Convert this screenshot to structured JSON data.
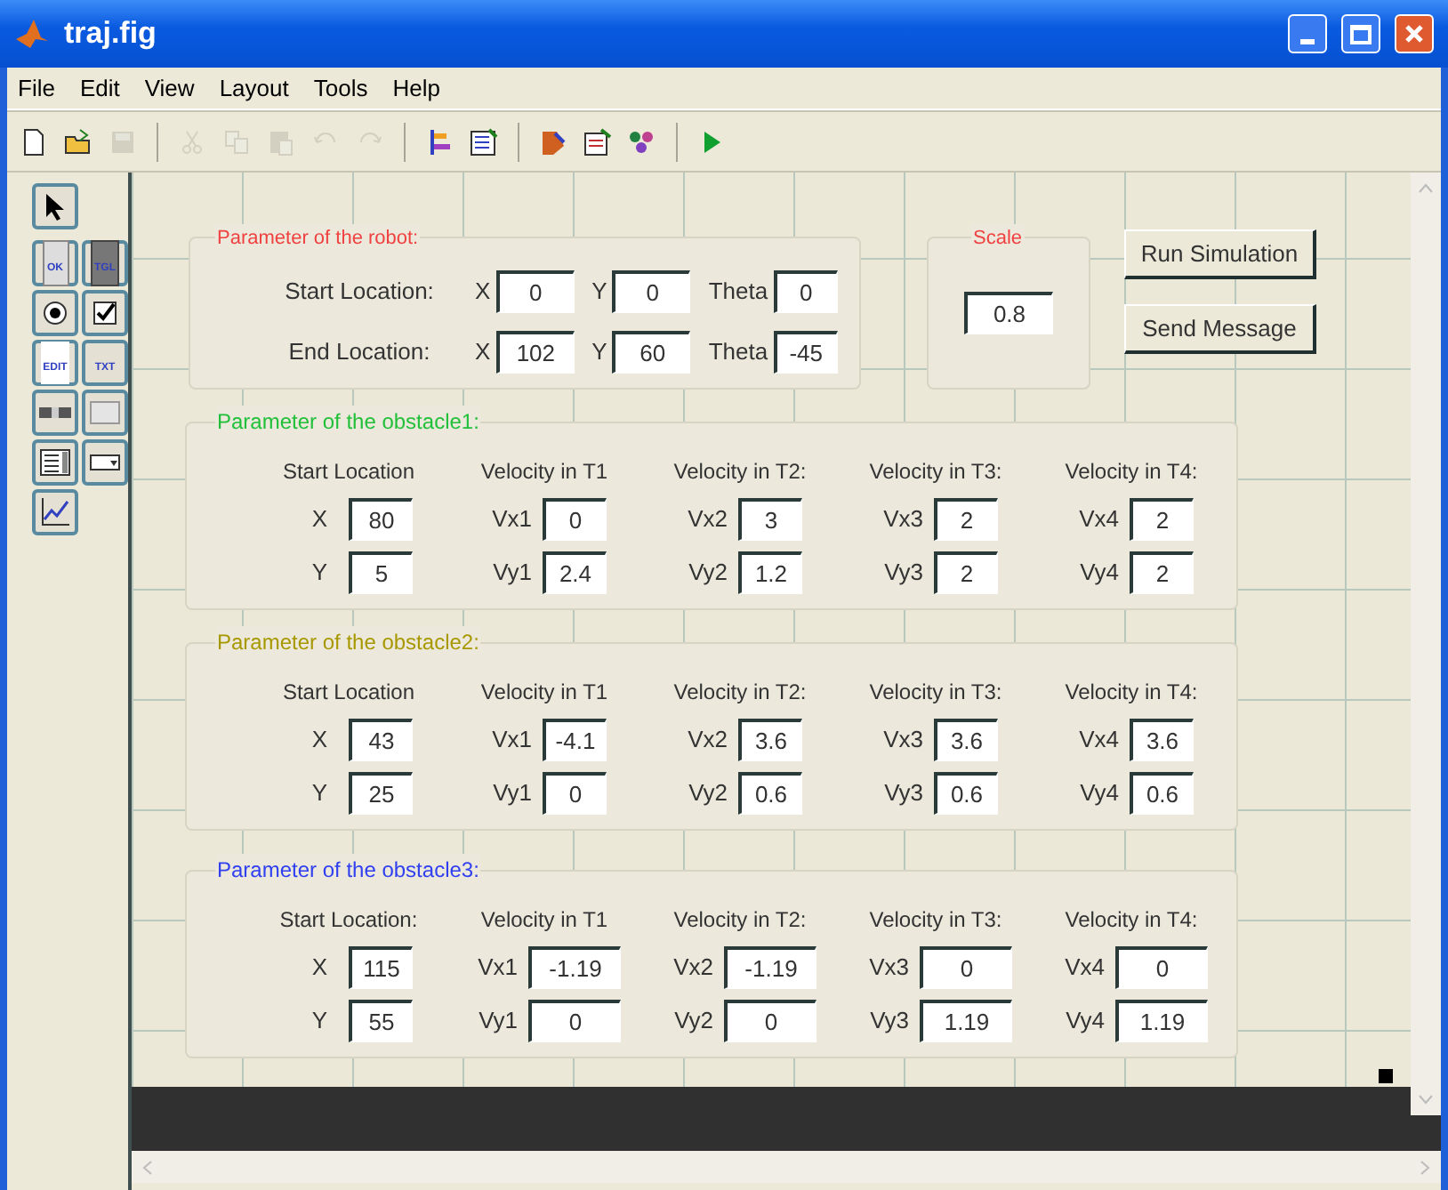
{
  "window": {
    "title": "traj.fig"
  },
  "menu": [
    "File",
    "Edit",
    "View",
    "Layout",
    "Tools",
    "Help"
  ],
  "toolbar": [
    {
      "kind": "new",
      "disabled": false
    },
    {
      "kind": "open",
      "disabled": false
    },
    {
      "kind": "save",
      "disabled": true
    },
    {
      "kind": "sep"
    },
    {
      "kind": "cut",
      "disabled": true
    },
    {
      "kind": "copy",
      "disabled": true
    },
    {
      "kind": "paste",
      "disabled": true
    },
    {
      "kind": "undo",
      "disabled": true
    },
    {
      "kind": "redo",
      "disabled": true
    },
    {
      "kind": "sep"
    },
    {
      "kind": "align",
      "disabled": false
    },
    {
      "kind": "menu-editor",
      "disabled": false
    },
    {
      "kind": "sep"
    },
    {
      "kind": "editor",
      "disabled": false
    },
    {
      "kind": "inspector",
      "disabled": false
    },
    {
      "kind": "browser",
      "disabled": false
    },
    {
      "kind": "sep"
    },
    {
      "kind": "run",
      "disabled": false
    }
  ],
  "palette": [
    {
      "kind": "pointer"
    },
    {
      "kind": "pushbutton",
      "label": "OK"
    },
    {
      "kind": "toggle",
      "label": "TGL"
    },
    {
      "kind": "radio"
    },
    {
      "kind": "checkbox"
    },
    {
      "kind": "edit",
      "label": "EDIT"
    },
    {
      "kind": "text",
      "label": "TXT"
    },
    {
      "kind": "slider"
    },
    {
      "kind": "frame"
    },
    {
      "kind": "listbox"
    },
    {
      "kind": "popup"
    },
    {
      "kind": "axes"
    }
  ],
  "robot": {
    "title": "Parameter of the robot:",
    "rows": [
      {
        "label": "Start Location:",
        "fields": [
          {
            "label": "X",
            "value": "0"
          },
          {
            "label": "Y",
            "value": "0"
          },
          {
            "label": "Theta",
            "value": "0"
          }
        ]
      },
      {
        "label": "End Location:",
        "fields": [
          {
            "label": "X",
            "value": "102"
          },
          {
            "label": "Y",
            "value": "60"
          },
          {
            "label": "Theta",
            "value": "-45"
          }
        ]
      }
    ]
  },
  "scale": {
    "title": "Scale",
    "value": "0.8"
  },
  "buttons": [
    "Run Simulation",
    "Send Message"
  ],
  "obstacles": [
    {
      "title": "Parameter of the obstacle1:",
      "color": "#22c03a",
      "columns": [
        {
          "heading": "Start Location",
          "fields": [
            {
              "label": "X",
              "value": "80"
            },
            {
              "label": "Y",
              "value": "5"
            }
          ]
        },
        {
          "heading": "Velocity in T1",
          "fields": [
            {
              "label": "Vx1",
              "value": "0"
            },
            {
              "label": "Vy1",
              "value": "2.4"
            }
          ]
        },
        {
          "heading": "Velocity in T2:",
          "fields": [
            {
              "label": "Vx2",
              "value": "3"
            },
            {
              "label": "Vy2",
              "value": "1.2"
            }
          ]
        },
        {
          "heading": "Velocity in T3:",
          "fields": [
            {
              "label": "Vx3",
              "value": "2"
            },
            {
              "label": "Vy3",
              "value": "2"
            }
          ]
        },
        {
          "heading": "Velocity in T4:",
          "fields": [
            {
              "label": "Vx4",
              "value": "2"
            },
            {
              "label": "Vy4",
              "value": "2"
            }
          ]
        }
      ]
    },
    {
      "title": "Parameter of the obstacle2:",
      "color": "#a89800",
      "columns": [
        {
          "heading": "Start Location",
          "fields": [
            {
              "label": "X",
              "value": "43"
            },
            {
              "label": "Y",
              "value": "25"
            }
          ]
        },
        {
          "heading": "Velocity in T1",
          "fields": [
            {
              "label": "Vx1",
              "value": "-4.1"
            },
            {
              "label": "Vy1",
              "value": "0"
            }
          ]
        },
        {
          "heading": "Velocity in T2:",
          "fields": [
            {
              "label": "Vx2",
              "value": "3.6"
            },
            {
              "label": "Vy2",
              "value": "0.6"
            }
          ]
        },
        {
          "heading": "Velocity in T3:",
          "fields": [
            {
              "label": "Vx3",
              "value": "3.6"
            },
            {
              "label": "Vy3",
              "value": "0.6"
            }
          ]
        },
        {
          "heading": "Velocity in T4:",
          "fields": [
            {
              "label": "Vx4",
              "value": "3.6"
            },
            {
              "label": "Vy4",
              "value": "0.6"
            }
          ]
        }
      ]
    },
    {
      "title": "Parameter of the obstacle3:",
      "color": "#3040f0",
      "columns": [
        {
          "heading": "Start Location:",
          "fields": [
            {
              "label": "X",
              "value": "115"
            },
            {
              "label": "Y",
              "value": "55"
            }
          ]
        },
        {
          "heading": "Velocity in T1",
          "fields": [
            {
              "label": "Vx1",
              "value": "-1.19"
            },
            {
              "label": "Vy1",
              "value": "0"
            }
          ]
        },
        {
          "heading": "Velocity in T2:",
          "fields": [
            {
              "label": "Vx2",
              "value": "-1.19"
            },
            {
              "label": "Vy2",
              "value": "0"
            }
          ]
        },
        {
          "heading": "Velocity in T3:",
          "fields": [
            {
              "label": "Vx3",
              "value": "0"
            },
            {
              "label": "Vy3",
              "value": "1.19"
            }
          ]
        },
        {
          "heading": "Velocity in T4:",
          "fields": [
            {
              "label": "Vx4",
              "value": "0"
            },
            {
              "label": "Vy4",
              "value": "1.19"
            }
          ]
        }
      ]
    }
  ]
}
